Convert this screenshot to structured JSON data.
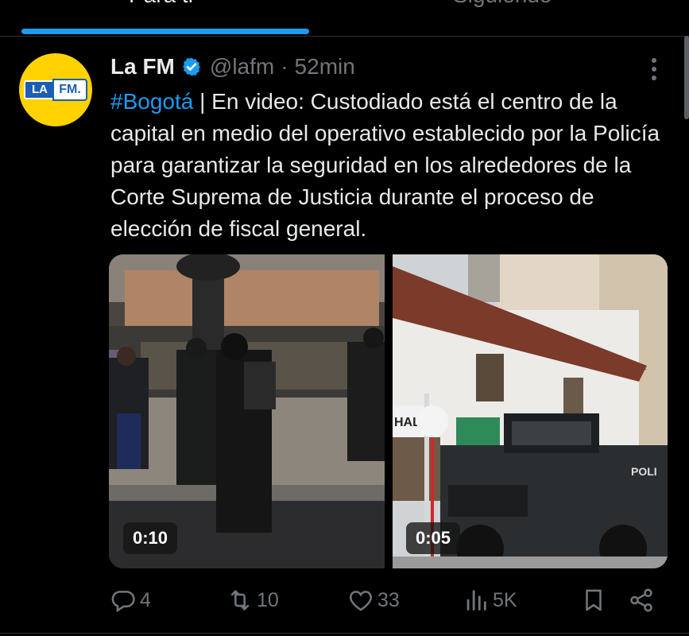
{
  "tabs": [
    {
      "label": "Para ti",
      "active": true
    },
    {
      "label": "Siguiendo",
      "active": false
    }
  ],
  "accent_color": "#1d9bf0",
  "tweet": {
    "avatar_logo": {
      "left": "LA",
      "right": "FM."
    },
    "author_name": "La FM",
    "verified_icon": "verified-badge-icon",
    "handle": "@lafm",
    "separator": "·",
    "time": "52min",
    "hashtag": "#Bogotá",
    "text": " | En video: Custodiado está el centro de la capital en medio del operativo establecido por la Policía para garantizar la seguridad en los alrededores de la Corte Suprema de Justicia durante el proceso de elección de fiscal general.",
    "media": [
      {
        "type": "video",
        "duration": "0:10"
      },
      {
        "type": "video",
        "duration": "0:05",
        "overlay_text": [
          "HALL",
          "POLI"
        ]
      }
    ],
    "actions": {
      "replies": "4",
      "retweets": "10",
      "likes": "33",
      "views": "5K"
    }
  }
}
